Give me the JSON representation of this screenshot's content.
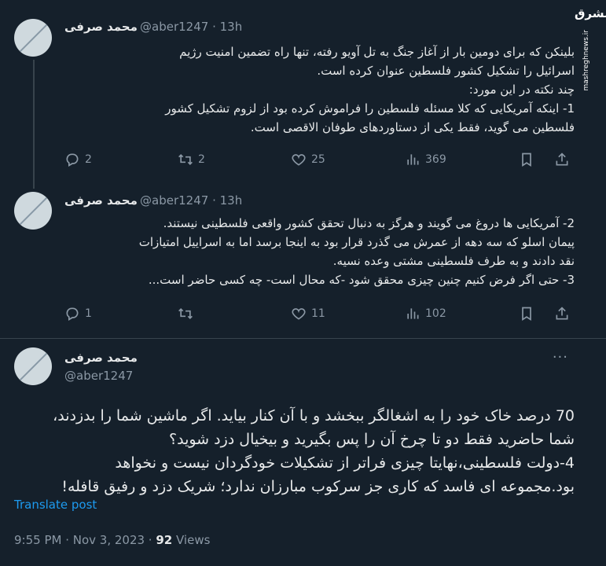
{
  "watermark": {
    "logo": "مشرق",
    "url": "mashreghnews.ir"
  },
  "tweets": [
    {
      "name": "محمد صرفی",
      "handle": "@aber1247",
      "time": "· 13h",
      "lines": [
        "بلینکن که برای دومین بار از آغاز جنگ به تل آویو رفته، تنها راه تضمین امنیت رژیم",
        "اسرائیل را تشکیل کشور فلسطین عنوان کرده است.",
        "چند نکته در این مورد:",
        "1- اینکه آمریکایی که کلا مسئله فلسطین را فراموش کرده بود از لزوم تشکیل کشور",
        "فلسطین می گوید، فقط یکی از دستاوردهای طوفان الاقصی است."
      ],
      "replies": "2",
      "retweets": "2",
      "likes": "25",
      "views": "369"
    },
    {
      "name": "محمد صرفی",
      "handle": "@aber1247",
      "time": "· 13h",
      "lines": [
        "2- آمریکایی ها دروغ می گویند و هرگز به دنبال تحقق کشور واقعی فلسطینی نیستند.",
        "پیمان اسلو که سه دهه از عمرش می گذرد قرار بود به اینجا برسد اما به اسراییل امتیازات",
        "نقد دادند و به طرف فلسطینی مشتی وعده نسیه.",
        "3- حتی اگر فرض کنیم چنین چیزی محقق شود -که محال است- چه کسی حاضر است..."
      ],
      "replies": "1",
      "retweets": "",
      "likes": "11",
      "views": "102"
    }
  ],
  "main": {
    "name": "محمد صرفی",
    "handle": "@aber1247",
    "more": "···",
    "lines": [
      "70 درصد خاک خود را به اشغالگر ببخشد و با آن کنار بیاید. اگر ماشین شما را بدزدند،",
      "شما حاضرید فقط دو تا چرخ آن را پس بگیرید و بیخیال دزد شوید؟",
      "4-دولت فلسطینی،نهایتا چیزی فراتر از تشکیلات خودگردان نیست و نخواهد",
      "بود.مجموعه ای فاسد که کاری جز سرکوب مبارزان ندارد؛ شریک دزد و رفیق قافله!"
    ],
    "translate": "Translate post",
    "timestamp": "9:55 PM · Nov 3, 2023 · ",
    "views_count": "92",
    "views_label": " Views"
  }
}
